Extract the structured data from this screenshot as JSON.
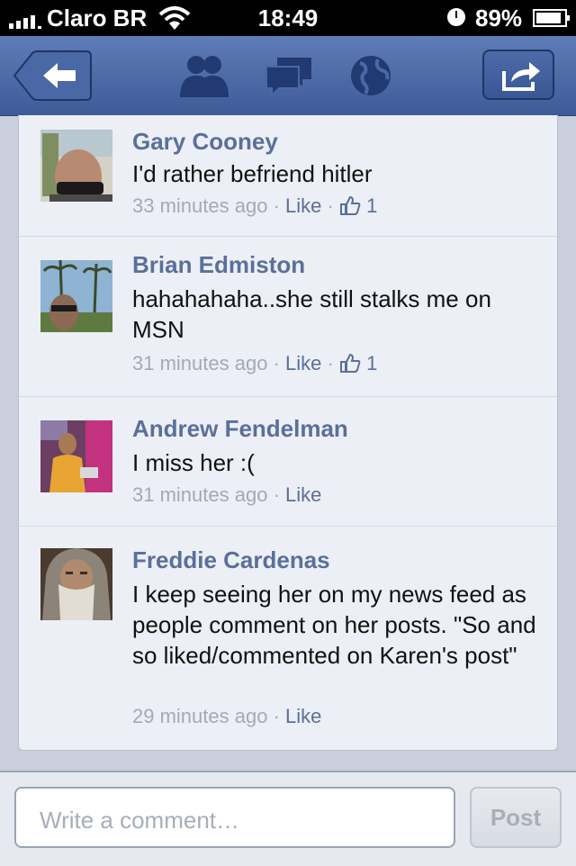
{
  "status_bar": {
    "carrier": "Claro BR",
    "time": "18:49",
    "battery": "89%",
    "battery_level": 0.89
  },
  "nav": {
    "icons": [
      "back-arrow-icon",
      "friend-requests-icon",
      "messages-icon",
      "notifications-globe-icon",
      "share-icon"
    ]
  },
  "comments": [
    {
      "author": "Gary Cooney",
      "text": "I'd rather befriend hitler",
      "time": "33 minutes ago",
      "like_label": "Like",
      "likes": "1"
    },
    {
      "author": "Brian Edmiston",
      "text": "hahahahaha..she still stalks me on MSN",
      "time": "31 minutes ago",
      "like_label": "Like",
      "likes": "1"
    },
    {
      "author": "Andrew Fendelman",
      "text": "I miss her :(",
      "time": "31 minutes ago",
      "like_label": "Like"
    },
    {
      "author": "Freddie Cardenas",
      "text": "I keep seeing her on my news feed as people comment on her posts. \"So and so liked/commented on Karen's post\"",
      "time": "29 minutes ago",
      "like_label": "Like"
    }
  ],
  "composer": {
    "placeholder": "Write a comment…",
    "post_label": "Post"
  },
  "colors": {
    "nav_blue": "#3e5b98",
    "link_blue": "#5a6f9b",
    "muted": "#a3a9b6"
  }
}
